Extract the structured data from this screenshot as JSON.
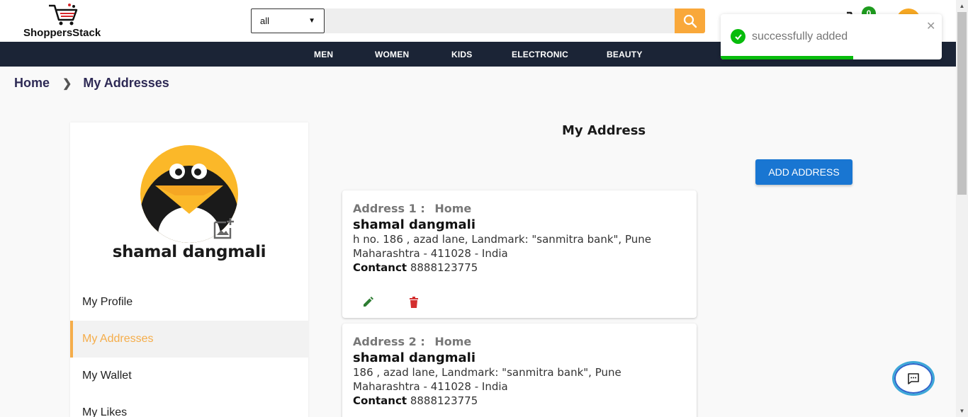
{
  "header": {
    "logo_text": "ShoppersStack",
    "category_select": "all",
    "cart_count": "0"
  },
  "nav": {
    "items": [
      "MEN",
      "WOMEN",
      "KIDS",
      "ELECTRONIC",
      "BEAUTY"
    ]
  },
  "breadcrumb": {
    "home": "Home",
    "current": "My Addresses"
  },
  "sidebar": {
    "name": "shamal dangmali",
    "items": [
      "My Profile",
      "My Addresses",
      "My Wallet",
      "My Likes"
    ],
    "active": "My Addresses"
  },
  "main": {
    "title": "My Address",
    "add_button": "ADD ADDRESS",
    "addresses": [
      {
        "label": "Address 1 :",
        "type": "Home",
        "name": "shamal dangmali",
        "line1": "h no. 186 , azad lane, Landmark: \"sanmitra bank\", Pune",
        "line2": "Maharashtra - 411028 - India",
        "contact_label": "Contanct",
        "contact": "8888123775"
      },
      {
        "label": "Address 2 :",
        "type": "Home",
        "name": "shamal dangmali",
        "line1": "186 , azad lane, Landmark: \"sanmitra bank\", Pune",
        "line2": "Maharashtra - 411028 - India",
        "contact_label": "Contanct",
        "contact": "8888123775"
      }
    ]
  },
  "toast": {
    "message": "successfully added",
    "progress": 0.6
  },
  "colors": {
    "accent": "#f9a83a",
    "nav_bg": "#1b2436",
    "button_blue": "#1976d2",
    "success": "#07bc0c"
  }
}
